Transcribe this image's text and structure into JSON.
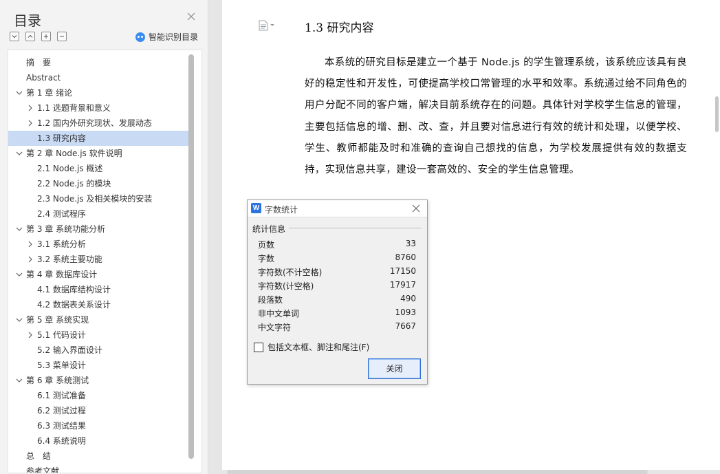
{
  "sidebar": {
    "title": "目录",
    "smart_toc_label": "智能识别目录",
    "toc": [
      {
        "label": "摘　要",
        "level": 0,
        "expander": "none"
      },
      {
        "label": "Abstract",
        "level": 0,
        "expander": "none"
      },
      {
        "label": "第 1 章  绪论",
        "level": 0,
        "expander": "expanded"
      },
      {
        "label": "1.1 选题背景和意义",
        "level": 1,
        "expander": "collapsed"
      },
      {
        "label": "1.2 国内外研究现状、发展动态",
        "level": 1,
        "expander": "collapsed"
      },
      {
        "label": "1.3 研究内容",
        "level": 1,
        "expander": "none",
        "selected": true
      },
      {
        "label": "第 2 章  Node.js 软件说明",
        "level": 0,
        "expander": "expanded"
      },
      {
        "label": "2.1 Node.js 概述",
        "level": 1,
        "expander": "none"
      },
      {
        "label": "2.2 Node.js 的模块",
        "level": 1,
        "expander": "none"
      },
      {
        "label": "2.3 Node.js 及相关模块的安装",
        "level": 1,
        "expander": "none"
      },
      {
        "label": "2.4  测试程序",
        "level": 1,
        "expander": "none"
      },
      {
        "label": "第 3 章  系统功能分析",
        "level": 0,
        "expander": "expanded"
      },
      {
        "label": "3.1 系统分析",
        "level": 1,
        "expander": "collapsed"
      },
      {
        "label": "3.2 系统主要功能",
        "level": 1,
        "expander": "collapsed"
      },
      {
        "label": "第 4 章  数据库设计",
        "level": 0,
        "expander": "expanded"
      },
      {
        "label": "4.1 数据库结构设计",
        "level": 1,
        "expander": "none"
      },
      {
        "label": "4.2 数据表关系设计",
        "level": 1,
        "expander": "none"
      },
      {
        "label": "第 5 章  系统实现",
        "level": 0,
        "expander": "expanded"
      },
      {
        "label": "5.1 代码设计",
        "level": 1,
        "expander": "collapsed"
      },
      {
        "label": "5.2 输入界面设计",
        "level": 1,
        "expander": "none"
      },
      {
        "label": "5.3 菜单设计",
        "level": 1,
        "expander": "none"
      },
      {
        "label": "第 6 章  系统测试",
        "level": 0,
        "expander": "expanded"
      },
      {
        "label": "6.1 测试准备",
        "level": 1,
        "expander": "none"
      },
      {
        "label": "6.2 测试过程",
        "level": 1,
        "expander": "none"
      },
      {
        "label": "6.3 测试结果",
        "level": 1,
        "expander": "none"
      },
      {
        "label": "6.4 系统说明",
        "level": 1,
        "expander": "none"
      },
      {
        "label": "总　结",
        "level": 0,
        "expander": "none"
      },
      {
        "label": "参考文献",
        "level": 0,
        "expander": "none"
      }
    ]
  },
  "document": {
    "heading": "1.3 研究内容",
    "paragraph": "本系统的研究目标是建立一个基于 Node.js 的学生管理系统，该系统应该具有良好的稳定性和开发性，可使提高学校口常管理的水平和效率。系统通过给不同角色的用户分配不同的客户端，解决目前系统存在的问题。具体针对学校学生信息的管理，主要包括信息的增、删、改、查，并且要对信息进行有效的统计和处理，以便学校、学生、教师都能及时和准确的查询自己想找的信息，为学校发展提供有效的数据支持，实现信息共享，建设一套高效的、安全的学生信息管理。"
  },
  "dialog": {
    "title": "字数统计",
    "group_label": "统计信息",
    "stats": [
      {
        "label": "页数",
        "value": "33"
      },
      {
        "label": "字数",
        "value": "8760"
      },
      {
        "label": "字符数(不计空格)",
        "value": "17150"
      },
      {
        "label": "字符数(计空格)",
        "value": "17917"
      },
      {
        "label": "段落数",
        "value": "490"
      },
      {
        "label": "非中文单词",
        "value": "1093"
      },
      {
        "label": "中文字符",
        "value": "7667"
      }
    ],
    "checkbox_label": "包括文本框、脚注和尾注(F)",
    "close_button": "关闭"
  }
}
